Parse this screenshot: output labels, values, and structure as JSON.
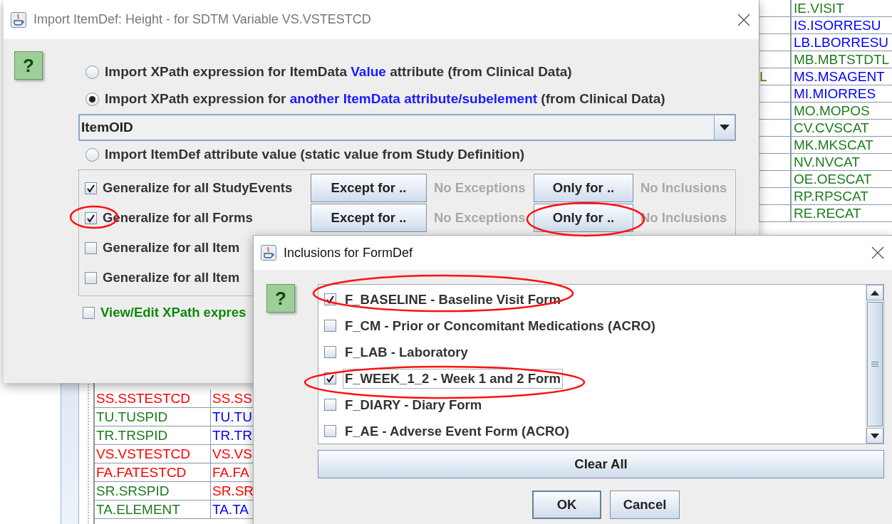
{
  "background_table_right": {
    "rows": [
      {
        "code": {
          "text": "IE.VISIT",
          "color": "#1e7b1e"
        }
      },
      {
        "code": {
          "text": "IS.ISORRESU",
          "color": "#0000ff"
        }
      },
      {
        "code": {
          "text": "LB.LBORRESU",
          "color": "#0000ff"
        }
      },
      {
        "code": {
          "text": "MB.MBTSTDTL",
          "color": "#1e7b1e"
        }
      },
      {
        "left": {
          "text": "L",
          "color": "#6b6b00"
        },
        "code": {
          "text": "MS.MSAGENT",
          "color": "#0000ff"
        }
      },
      {
        "code": {
          "text": "MI.MIORRES",
          "color": "#0000ff"
        }
      },
      {
        "code": {
          "text": "MO.MOPOS",
          "color": "#1e7b1e"
        }
      },
      {
        "code": {
          "text": "CV.CVSCAT",
          "color": "#1e7b1e"
        }
      },
      {
        "code": {
          "text": "MK.MKSCAT",
          "color": "#1e7b1e"
        }
      },
      {
        "code": {
          "text": "NV.NVCAT",
          "color": "#1e7b1e"
        }
      },
      {
        "code": {
          "text": "OE.OESCAT",
          "color": "#1e7b1e"
        }
      },
      {
        "code": {
          "text": "RP.RPSCAT",
          "color": "#1e7b1e"
        }
      },
      {
        "code": {
          "text": "RE.RECAT",
          "color": "#1e7b1e"
        }
      }
    ]
  },
  "background_table_left": {
    "rows": [
      {
        "cells": [
          {
            "text": "SS.SSTESTCD",
            "color": "#ff0000"
          },
          {
            "text": "SS.SS",
            "color": "#ff0000"
          }
        ]
      },
      {
        "cells": [
          {
            "text": "TU.TUSPID",
            "color": "#1e7b1e"
          },
          {
            "text": "TU.TU",
            "color": "#0000ff"
          }
        ]
      },
      {
        "cells": [
          {
            "text": "TR.TRSPID",
            "color": "#1e7b1e"
          },
          {
            "text": "TR.TR",
            "color": "#0000ff"
          }
        ]
      },
      {
        "cells": [
          {
            "text": "VS.VSTESTCD",
            "color": "#ff0000"
          },
          {
            "text": "VS.VS",
            "color": "#ff0000"
          }
        ]
      },
      {
        "cells": [
          {
            "text": "FA.FATESTCD",
            "color": "#ff0000"
          },
          {
            "text": "FA.FA",
            "color": "#ff0000"
          }
        ]
      },
      {
        "cells": [
          {
            "text": "SR.SRSPID",
            "color": "#1e7b1e"
          },
          {
            "text": "SR.SR",
            "color": "#ff0000"
          }
        ]
      },
      {
        "cells": [
          {
            "text": "TA.ELEMENT",
            "color": "#1e7b1e"
          },
          {
            "text": "TA.TA",
            "color": "#0000ff"
          }
        ]
      }
    ]
  },
  "import_dialog": {
    "title": "Import ItemDef: Height - for SDTM Variable VS.VSTESTCD",
    "help_button": "?",
    "options": [
      {
        "selected": false,
        "parts": [
          {
            "kind": "plain",
            "text": "Import XPath expression for ItemData "
          },
          {
            "kind": "highlight",
            "text": "Value"
          },
          {
            "kind": "plain",
            "text": " attribute (from Clinical Data)"
          }
        ]
      },
      {
        "selected": true,
        "parts": [
          {
            "kind": "plain",
            "text": "Import XPath expression for "
          },
          {
            "kind": "highlight",
            "text": "another ItemData attribute/subelement"
          },
          {
            "kind": "plain",
            "text": " (from Clinical Data)"
          }
        ],
        "combo": {
          "value": "ItemOID"
        }
      },
      {
        "selected": false,
        "parts": [
          {
            "kind": "plain",
            "text": "Import ItemDef attribute value (static value from Study Definition)"
          }
        ]
      }
    ],
    "generalize": [
      {
        "label": "Generalize for all StudyEvents",
        "checked": true,
        "except_button": "Except for ..",
        "exceptions_status": "No Exceptions",
        "only_button": "Only for ..",
        "inclusions_status": "No Inclusions"
      },
      {
        "label": "Generalize for all Forms",
        "checked": true,
        "except_button": "Except for ..",
        "exceptions_status": "No Exceptions",
        "only_button": "Only for ..",
        "inclusions_status": "No Inclusions"
      },
      {
        "label": "Generalize for all Item",
        "checked": false
      },
      {
        "label": "Generalize for all Item",
        "checked": false
      }
    ],
    "view_edit": {
      "label": "View/Edit XPath expres",
      "checked": false
    }
  },
  "inclusions_dialog": {
    "title": "Inclusions for FormDef",
    "help_button": "?",
    "forms": [
      {
        "label": "F_BASELINE - Baseline Visit Form",
        "checked": true,
        "focused": false
      },
      {
        "label": "F_CM - Prior or Concomitant Medications (ACRO)",
        "checked": false,
        "focused": false
      },
      {
        "label": "F_LAB - Laboratory",
        "checked": false,
        "focused": false
      },
      {
        "label": "F_WEEK_1_2 - Week 1 and 2 Form",
        "checked": true,
        "focused": true
      },
      {
        "label": "F_DIARY - Diary Form",
        "checked": false,
        "focused": false
      },
      {
        "label": "F_AE - Adverse Event Form (ACRO)",
        "checked": false,
        "focused": false
      }
    ],
    "clear_button": "Clear All",
    "buttons": [
      "OK",
      "Cancel"
    ]
  }
}
